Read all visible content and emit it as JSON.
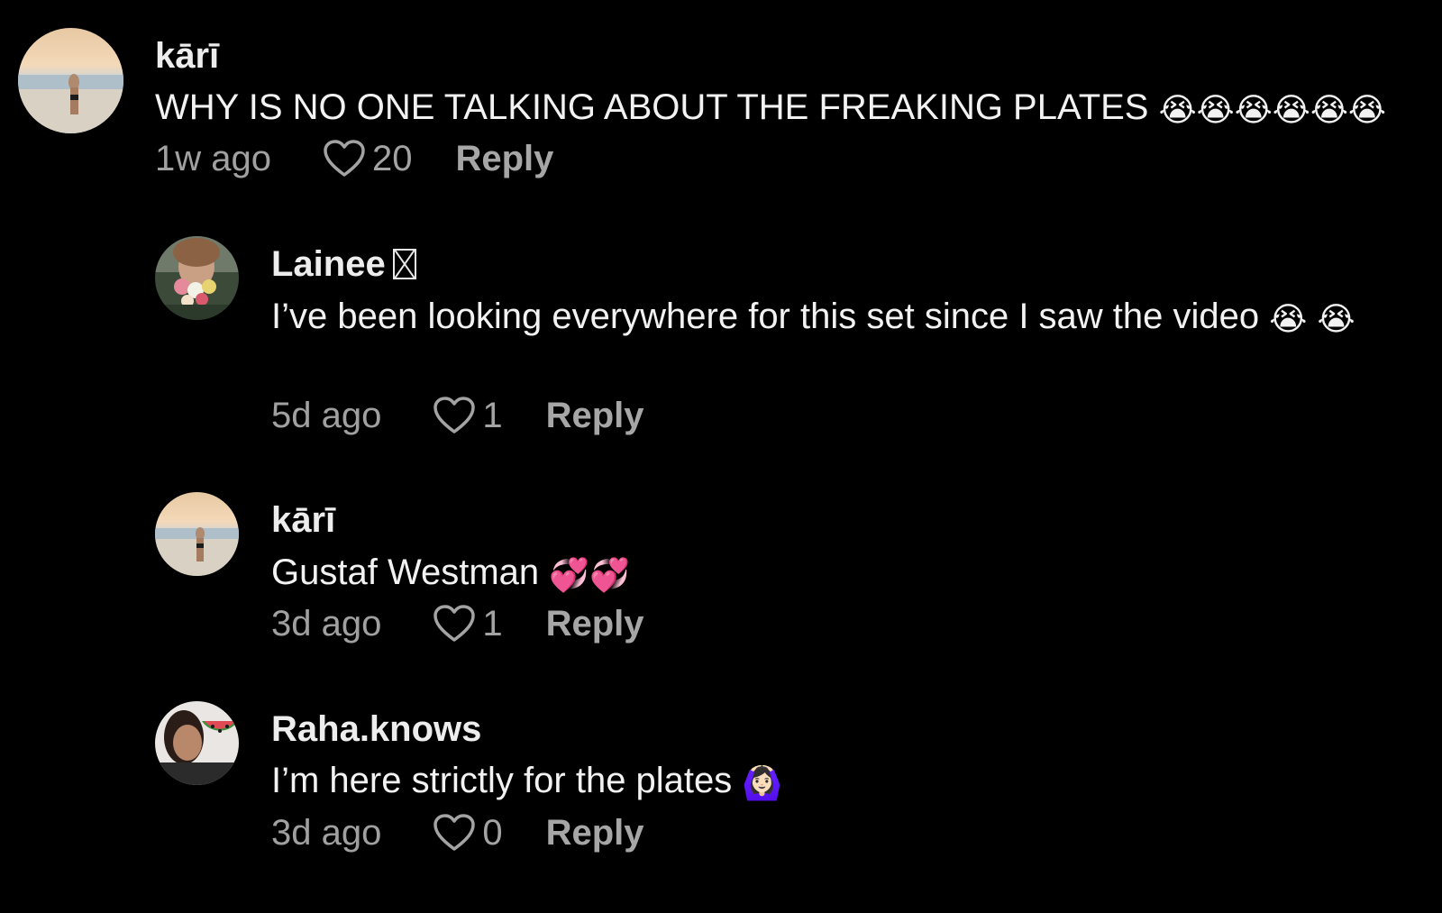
{
  "colors": {
    "background": "#000000",
    "text": "#f2f2f2",
    "muted": "#a3a3a3"
  },
  "comments": [
    {
      "author": "kārī",
      "text": "WHY IS NO ONE TALKING ABOUT THE FREAKING PLATES",
      "emoji": "😭😭😭😭😭😭",
      "time": "1w ago",
      "likes": "20",
      "reply_label": "Reply",
      "avatar_icon": "beach-photo-avatar"
    },
    {
      "author": "Lainee",
      "badge_icon": "missing-glyph-icon",
      "text": "I’ve been looking everywhere for this set since I saw the video",
      "emoji": "😭",
      "emoji_wrap": "😭",
      "time": "5d ago",
      "likes": "1",
      "reply_label": "Reply",
      "avatar_icon": "flowers-photo-avatar"
    },
    {
      "author": "kārī",
      "text": "Gustaf Westman",
      "emoji": "💞💞",
      "time": "3d ago",
      "likes": "1",
      "reply_label": "Reply",
      "avatar_icon": "beach-photo-avatar"
    },
    {
      "author": "Raha.knows",
      "text": "I’m here strictly for the plates",
      "emoji": "🙆🏻‍♀️",
      "time": "3d ago",
      "likes": "0",
      "reply_label": "Reply",
      "avatar_icon": "watermelon-photo-avatar"
    }
  ]
}
